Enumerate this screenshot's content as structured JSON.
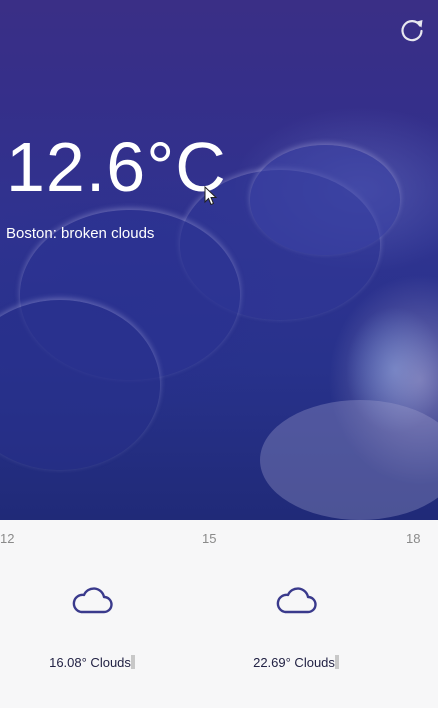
{
  "current": {
    "temperature": "12.6°C",
    "description": "Boston: broken clouds"
  },
  "header": {
    "refresh_icon": "refresh-icon"
  },
  "forecast": {
    "hours": [
      "12",
      "15",
      "18"
    ],
    "items": [
      {
        "icon": "cloud-icon",
        "text": "16.08° Clouds"
      },
      {
        "icon": "cloud-icon",
        "text": "22.69° Clouds"
      }
    ]
  },
  "colors": {
    "hero_top": "#3a2f86",
    "hero_bottom": "#202a78",
    "icon_stroke": "#3a3a8c",
    "forecast_bg": "#f7f7f8"
  }
}
